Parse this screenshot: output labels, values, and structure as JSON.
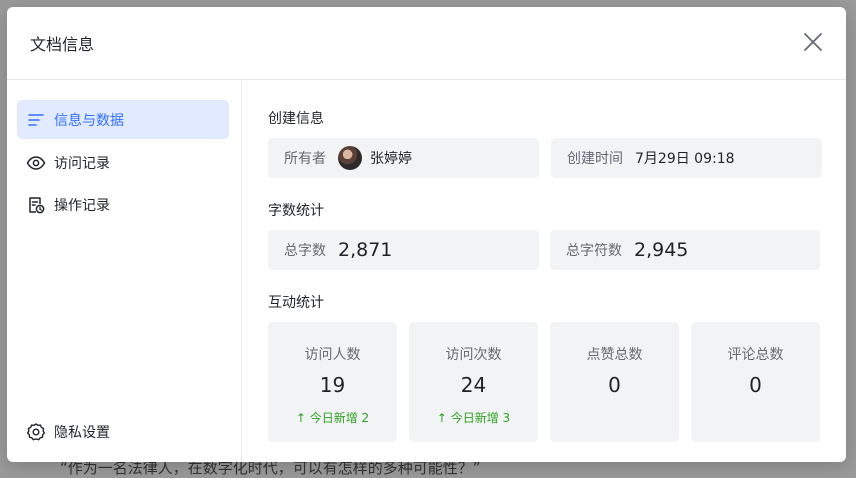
{
  "backdrop": {
    "text": "“作为一名法律人，在数字化时代，可以有怎样的多种可能性？”"
  },
  "modal": {
    "title": "文档信息"
  },
  "sidebar": {
    "items": [
      {
        "label": "信息与数据",
        "icon": "list-lines-icon",
        "active": true
      },
      {
        "label": "访问记录",
        "icon": "eye-icon",
        "active": false
      },
      {
        "label": "操作记录",
        "icon": "doc-clock-icon",
        "active": false
      }
    ],
    "privacy": {
      "label": "隐私设置",
      "icon": "gear-icon"
    }
  },
  "creation": {
    "section_title": "创建信息",
    "owner_label": "所有者",
    "owner_name": "张婷婷",
    "time_label": "创建时间",
    "time_value": "7月29日 09:18"
  },
  "wordcount": {
    "section_title": "字数统计",
    "words_label": "总字数",
    "words_value": "2,871",
    "chars_label": "总字符数",
    "chars_value": "2,945"
  },
  "interaction": {
    "section_title": "互动统计",
    "cards": [
      {
        "label": "访问人数",
        "value": "19",
        "delta": "今日新增 2"
      },
      {
        "label": "访问次数",
        "value": "24",
        "delta": "今日新增 3"
      },
      {
        "label": "点赞总数",
        "value": "0",
        "delta": ""
      },
      {
        "label": "评论总数",
        "value": "0",
        "delta": ""
      }
    ]
  },
  "colors": {
    "accent": "#3370ff",
    "active_bg": "#e1eaff",
    "positive": "#2ea121"
  }
}
